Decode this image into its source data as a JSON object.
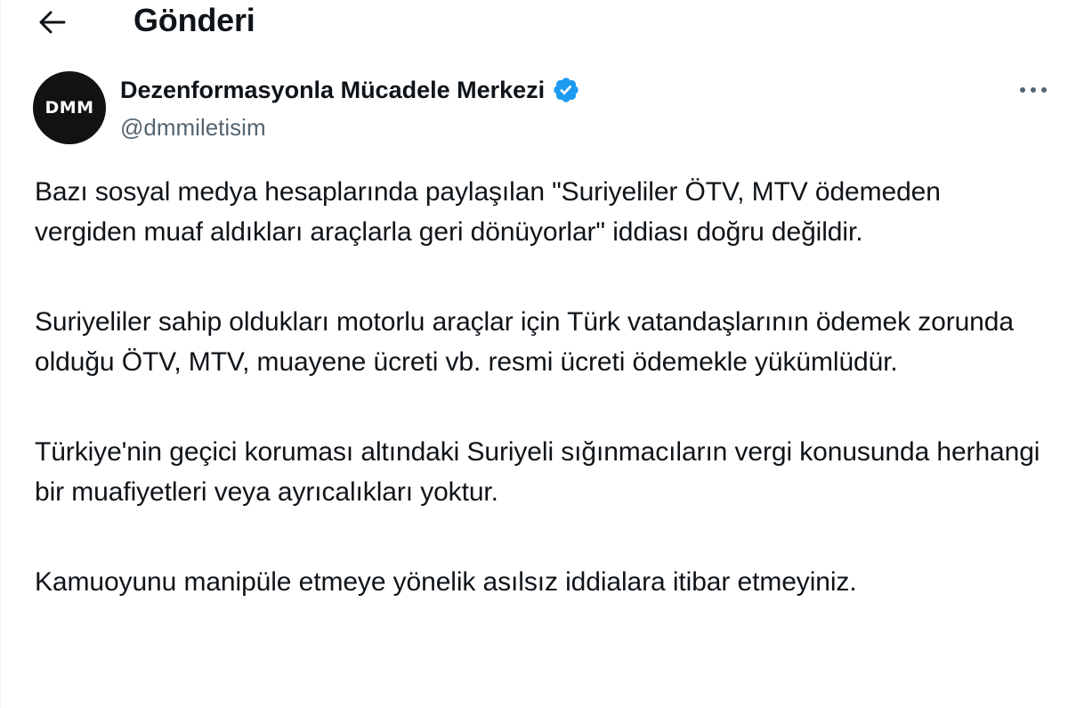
{
  "header": {
    "title": "Gönderi",
    "back_icon": "arrow-left-icon"
  },
  "author": {
    "avatar_text": "DMM",
    "name": "Dezenformasyonla Mücadele Merkezi",
    "handle": "@dmmiletisim",
    "verified_icon": "verified-badge-icon",
    "verified_color": "#1d9bf0",
    "more_icon": "more-horizontal-icon"
  },
  "post": {
    "paragraphs": [
      "Bazı sosyal medya hesaplarında paylaşılan \"Suriyeliler ÖTV, MTV ödemeden vergiden muaf aldıkları araçlarla geri dönüyorlar\" iddiası doğru değildir.",
      "Suriyeliler sahip oldukları motorlu araçlar için Türk vatandaşlarının ödemek zorunda olduğu ÖTV, MTV, muayene ücreti vb. resmi ücreti ödemekle yükümlüdür.",
      "Türkiye'nin geçici koruması altındaki Suriyeli sığınmacıların vergi konusunda herhangi bir muafiyetleri veya ayrıcalıkları yoktur.",
      "Kamuoyunu manipüle etmeye yönelik asılsız iddialara itibar etmeyiniz."
    ]
  },
  "colors": {
    "text": "#0f1419",
    "secondary_text": "#536471",
    "background": "#ffffff"
  }
}
